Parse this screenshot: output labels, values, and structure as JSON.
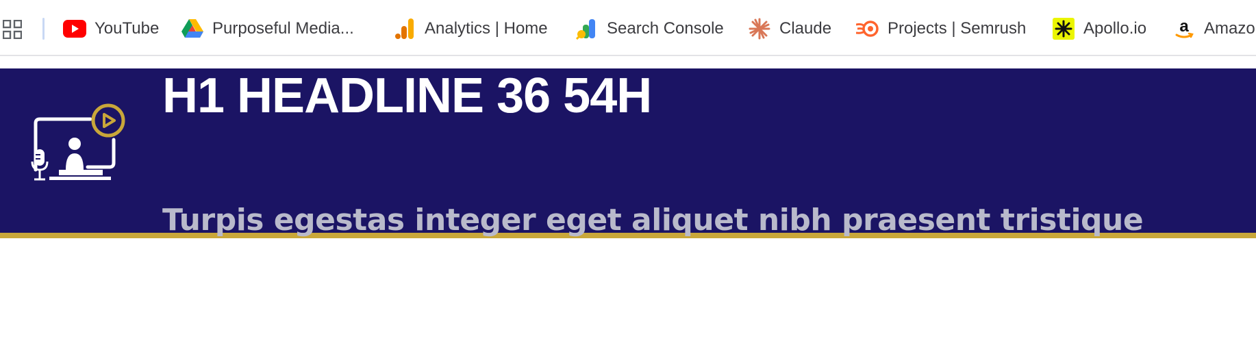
{
  "bookmarks_bar": {
    "items": [
      {
        "label": "YouTube",
        "icon": "youtube-icon"
      },
      {
        "label": "Purposeful Media...",
        "icon": "google-drive-icon"
      },
      {
        "label": "Analytics | Home",
        "icon": "google-analytics-icon"
      },
      {
        "label": "Search Console",
        "icon": "search-console-icon"
      },
      {
        "label": "Claude",
        "icon": "claude-icon"
      },
      {
        "label": "Projects | Semrush",
        "icon": "semrush-icon"
      },
      {
        "label": "Apollo.io",
        "icon": "apollo-icon"
      },
      {
        "label": "Amazo",
        "icon": "amazon-icon"
      }
    ]
  },
  "hero": {
    "headline": "H1 HEADLINE 36 54H",
    "subline": "Turpis egestas integer eget aliquet nibh praesent tristique",
    "icon": "video-podcast-icon"
  },
  "colors": {
    "hero_background": "#1b1464",
    "accent_gold": "#c9a73a",
    "headline": "#ffffff",
    "subline": "#b9bacb"
  }
}
